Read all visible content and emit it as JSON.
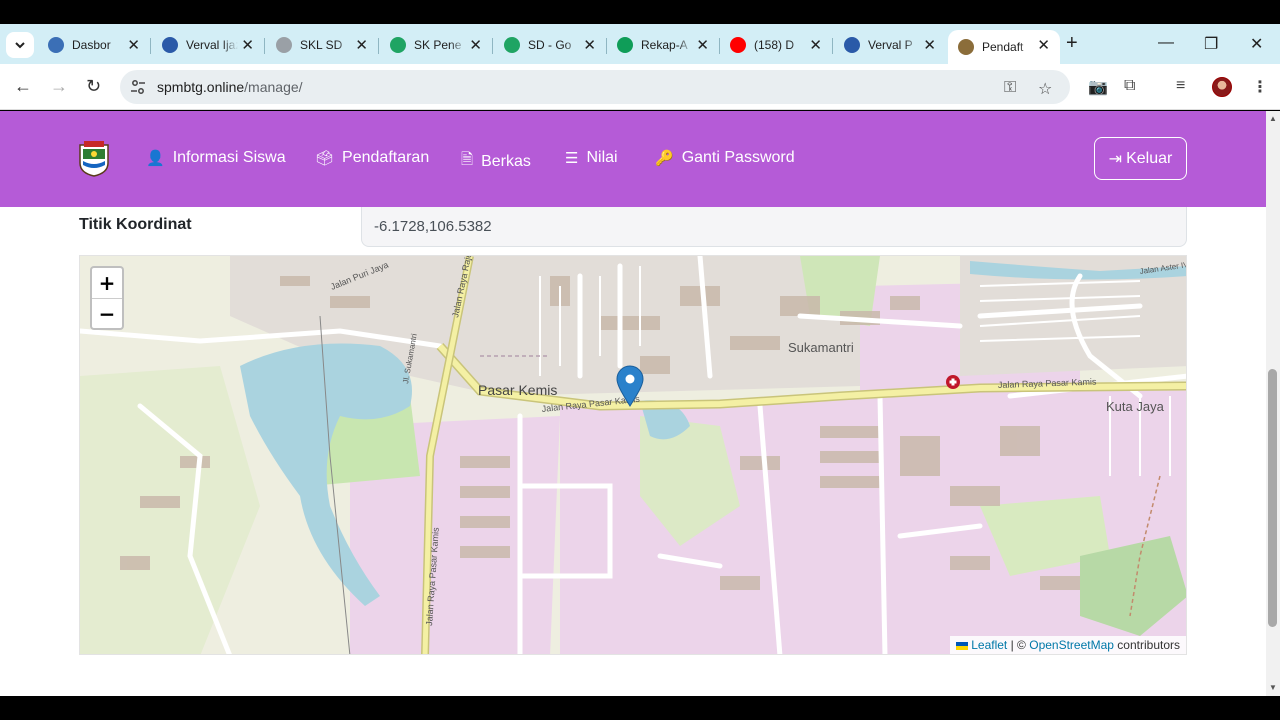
{
  "browser": {
    "tabs": [
      {
        "label": "Dasbor",
        "favicon_color": "#3b6fb6"
      },
      {
        "label": "Verval Ijazah",
        "favicon_color": "#2a5aa8"
      },
      {
        "label": "SKL SD",
        "favicon_color": "#9aa0a6"
      },
      {
        "label": "SK Pene",
        "favicon_color": "#1fa463"
      },
      {
        "label": "SD - Go",
        "favicon_color": "#1fa463"
      },
      {
        "label": "Rekap-A",
        "favicon_color": "#0f9d58"
      },
      {
        "label": "(158) D",
        "favicon_color": "#ff0000"
      },
      {
        "label": "Verval P",
        "favicon_color": "#2a5aa8"
      },
      {
        "label": "Pendaft",
        "favicon_color": "#8b6d3a"
      }
    ],
    "active_tab_index": 8,
    "url_host": "spmbtg.online",
    "url_path": "/manage/"
  },
  "navbar": {
    "items": [
      {
        "label": "Informasi Siswa",
        "icon": "user-icon"
      },
      {
        "label": "Pendaftaran",
        "icon": "inbox-check-icon"
      },
      {
        "label": "Berkas",
        "icon": "file-icon"
      },
      {
        "label": "Nilai",
        "icon": "list-ol-icon"
      },
      {
        "label": "Ganti Password",
        "icon": "key-icon"
      }
    ],
    "logout_label": "Keluar",
    "color": "#b55bd7"
  },
  "form": {
    "coord_label": "Titik Koordinat",
    "coord_value": "-6.1728,106.5382"
  },
  "map": {
    "labels": {
      "street_puri": "Jalan Puri Jaya",
      "street_rajeg": "Jalan Raya Rajeg",
      "street_aster": "Jalan Aster IV",
      "street_main_west": "Jalan Raya Pasar Kamis",
      "street_main_east": "Jalan Raya Pasar Kamis",
      "street_south": "Jalan Raya Pasar Kamis",
      "street_sukasari": "Jl. Sukamantri",
      "place_pasar_kemis": "Pasar Kemis",
      "place_sukamantri": "Sukamantri",
      "place_kuta_jaya": "Kuta Jaya"
    },
    "zoom_in": "+",
    "zoom_out": "−",
    "attribution": {
      "leaflet": "Leaflet",
      "sep": "| ©",
      "osm": "OpenStreetMap",
      "contributors": "contributors"
    }
  }
}
